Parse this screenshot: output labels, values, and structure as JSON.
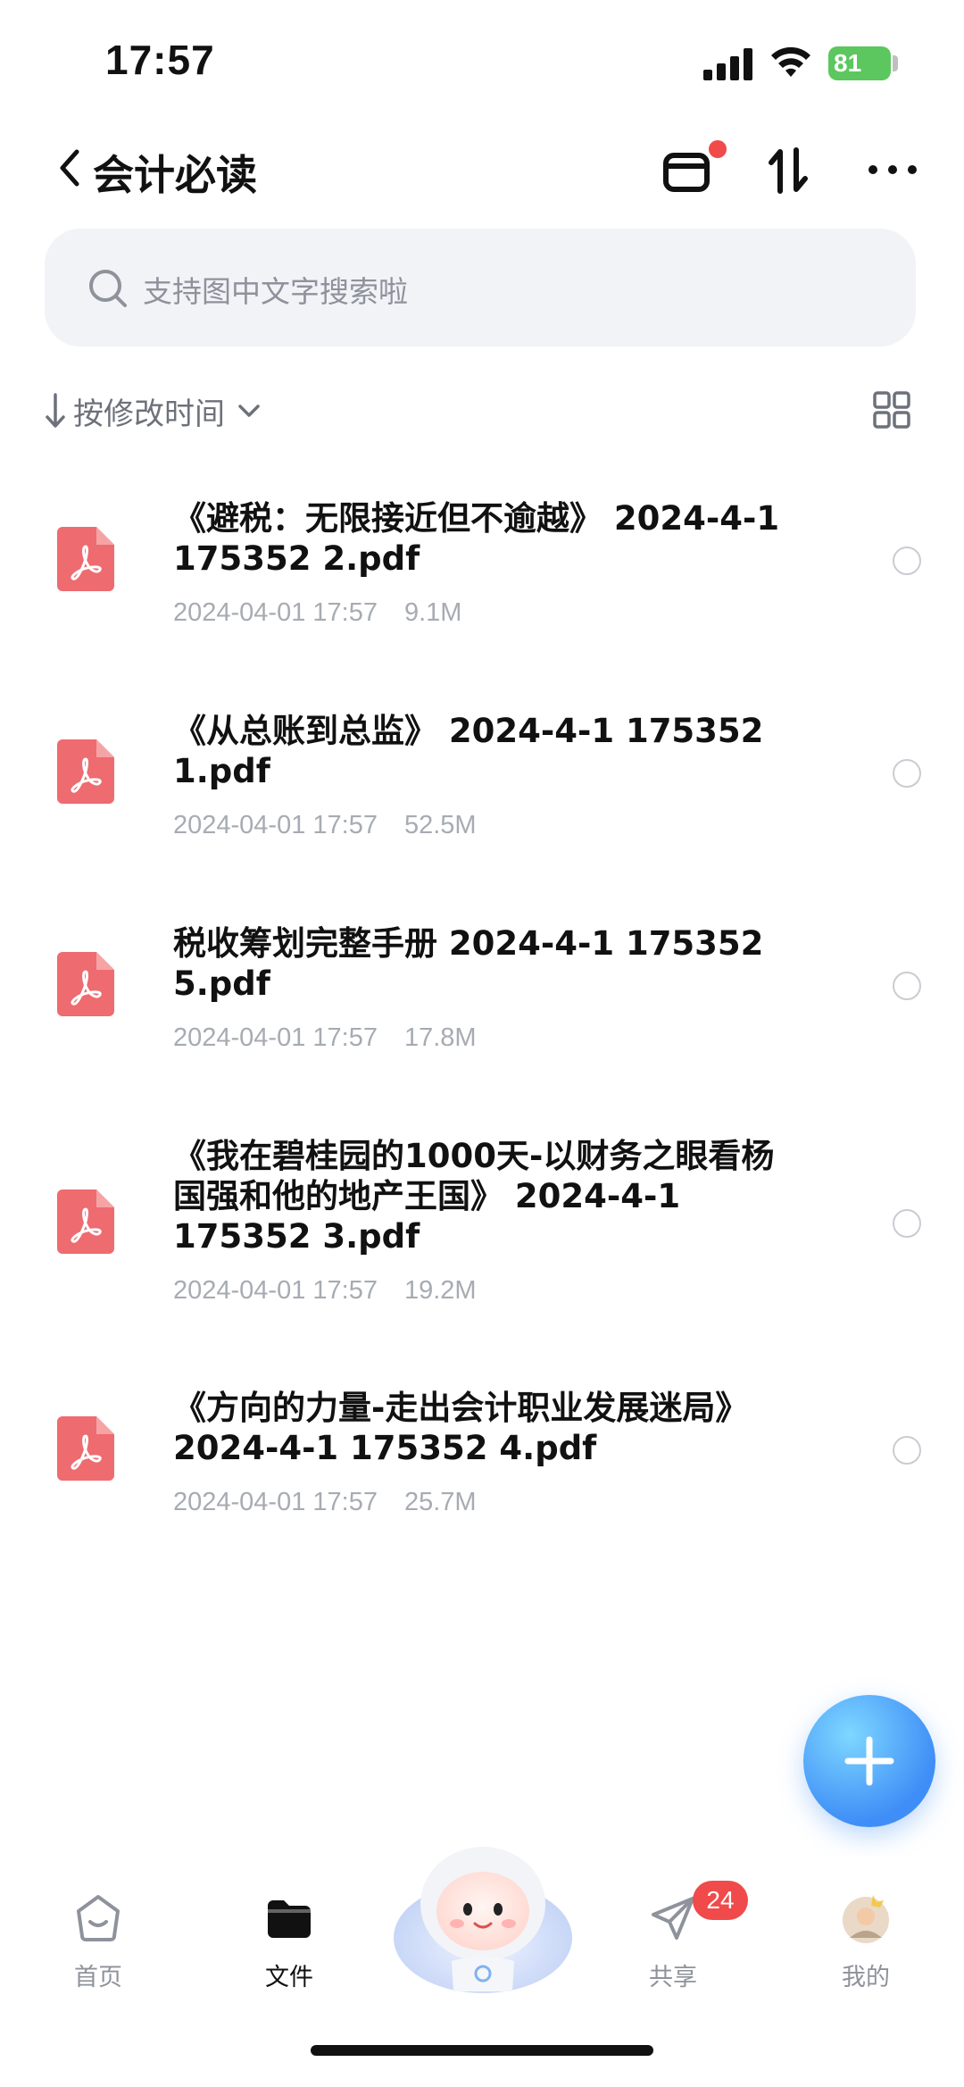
{
  "status_bar": {
    "time": "17:57",
    "battery": "81"
  },
  "nav": {
    "title": "会计必读"
  },
  "search": {
    "placeholder": "支持图中文字搜索啦"
  },
  "sort": {
    "label": "按修改时间"
  },
  "files": [
    {
      "name": "《避税：无限接近但不逾越》 2024-4-1 175352 2.pdf",
      "date": "2024-04-01 17:57",
      "size": "9.1M"
    },
    {
      "name": "《从总账到总监》 2024-4-1 175352 1.pdf",
      "date": "2024-04-01 17:57",
      "size": "52.5M"
    },
    {
      "name": "税收筹划完整手册 2024-4-1 175352 5.pdf",
      "date": "2024-04-01 17:57",
      "size": "17.8M"
    },
    {
      "name": "《我在碧桂园的1000天-以财务之眼看杨国强和他的地产王国》 2024-4-1 175352 3.pdf",
      "date": "2024-04-01 17:57",
      "size": "19.2M"
    },
    {
      "name": "《方向的力量-走出会计职业发展迷局》 2024-4-1 175352 4.pdf",
      "date": "2024-04-01 17:57",
      "size": "25.7M"
    }
  ],
  "tabs": {
    "home": "首页",
    "files": "文件",
    "share": "共享",
    "mine": "我的",
    "share_badge": "24"
  },
  "colors": {
    "accent": "#3f8ef7",
    "pdf_red": "#ee6b70",
    "badge_red": "#f04a4a"
  }
}
